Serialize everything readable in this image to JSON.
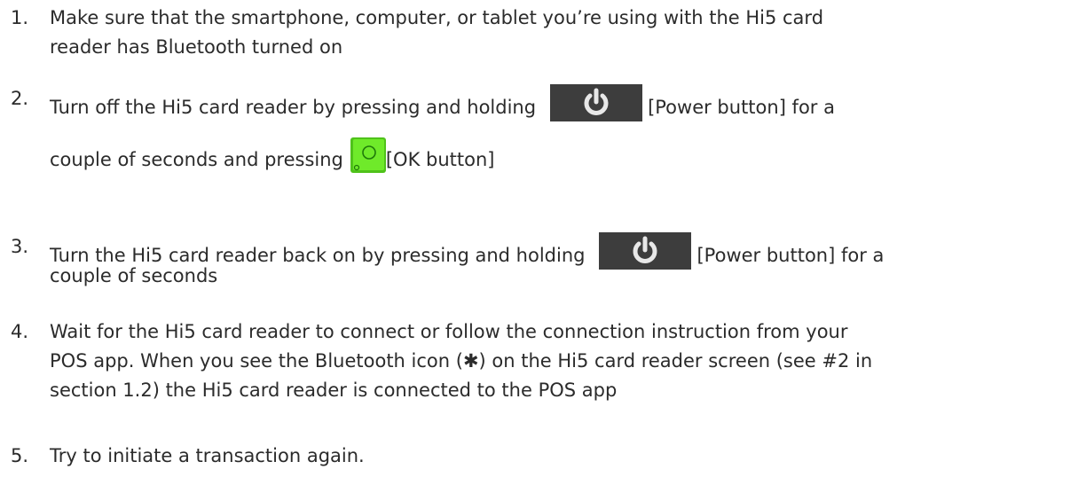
{
  "steps": [
    {
      "number": "1.",
      "line1": "Make sure that the smartphone, computer, or tablet you’re using with the Hi5 card",
      "line2": "reader has Bluetooth turned on"
    },
    {
      "number": "2.",
      "line1_pre": "Turn off the Hi5 card reader by pressing and holding",
      "line1_post": "[Power button] for a",
      "line2_pre": "couple of seconds and pressing",
      "line2_post": "[OK button]"
    },
    {
      "number": "3.",
      "line1_pre": "Turn the Hi5 card reader back on by pressing and holding",
      "line1_post": "[Power button] for a",
      "line2": "couple of seconds"
    },
    {
      "number": "4.",
      "line1": "Wait for the Hi5 card reader to connect or follow the connection instruction from your",
      "line2": "POS app. When you see the Bluetooth icon (✱) on the Hi5 card reader screen (see #2 in",
      "line3": "section 1.2) the Hi5 card reader is connected to the POS app"
    },
    {
      "number": "5.",
      "line1": "Try to initiate a transaction again."
    }
  ],
  "icons": {
    "power_button": "power-icon",
    "ok_button": "ok-button-icon"
  },
  "colors": {
    "text": "#2b2b2b",
    "power_button_bg": "#3d3d3d",
    "power_symbol": "#e8e8e8",
    "ok_button_green": "#5fe020"
  }
}
